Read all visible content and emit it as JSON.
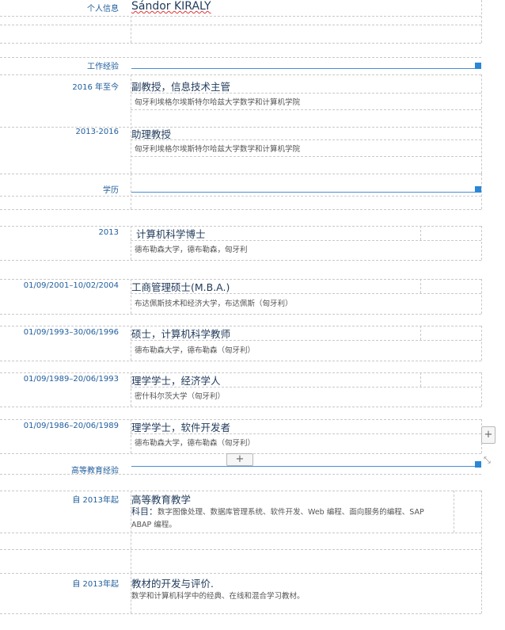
{
  "personal": {
    "label": "个人信息",
    "name": "Sándor KIRALY"
  },
  "work": {
    "label": "工作经验",
    "items": [
      {
        "date": "2016 年至今",
        "title": "副教授，信息技术主管",
        "desc": "匈牙利埃格尔埃斯特尔哈兹大学数学和计算机学院"
      },
      {
        "date": "2013-2016",
        "title": "助理教授",
        "desc": "匈牙利埃格尔埃斯特尔哈兹大学数学和计算机学院"
      }
    ]
  },
  "education": {
    "label": "学历",
    "items": [
      {
        "date": "2013",
        "title": "计算机科学博士",
        "desc": "德布勒森大学，德布勒森，匈牙利"
      },
      {
        "date": "01/09/2001–10/02/2004",
        "title": "工商管理硕士(M.B.A.)",
        "desc": "布达佩斯技术和经济大学，布达佩斯（匈牙利）"
      },
      {
        "date": "01/09/1993–30/06/1996",
        "title": "硕士，计算机科学教师",
        "desc": "德布勒森大学，德布勒森（匈牙利）"
      },
      {
        "date": "01/09/1989–20/06/1993",
        "title": "理学学士，经济学人",
        "desc": "密什科尔茨大学（匈牙利）"
      },
      {
        "date": "01/09/1986–20/06/1989",
        "title": "理学学士，软件开发者",
        "desc": "德布勒森大学，德布勒森（匈牙利）"
      }
    ]
  },
  "teaching": {
    "label": "高等教育经验",
    "items": [
      {
        "date": "自 2013年起",
        "title": "高等教育教学",
        "desc_prefix": "科目：",
        "desc": "数字图像处理、数据库管理系统、软件开发、Web 编程、面向服务的编程、SAP",
        "desc2": "ABAP 编程。"
      },
      {
        "date": "自 2013年起",
        "title": "教材的开发与评价.",
        "desc": "数学和计算机科学中的经典、在线和混合学习教材。"
      }
    ]
  },
  "controls": {
    "plus": "+",
    "resize": "⤡"
  },
  "colors": {
    "accent": "#2a86d6",
    "label": "#1f5d9b",
    "text": "#1f3a5a"
  }
}
